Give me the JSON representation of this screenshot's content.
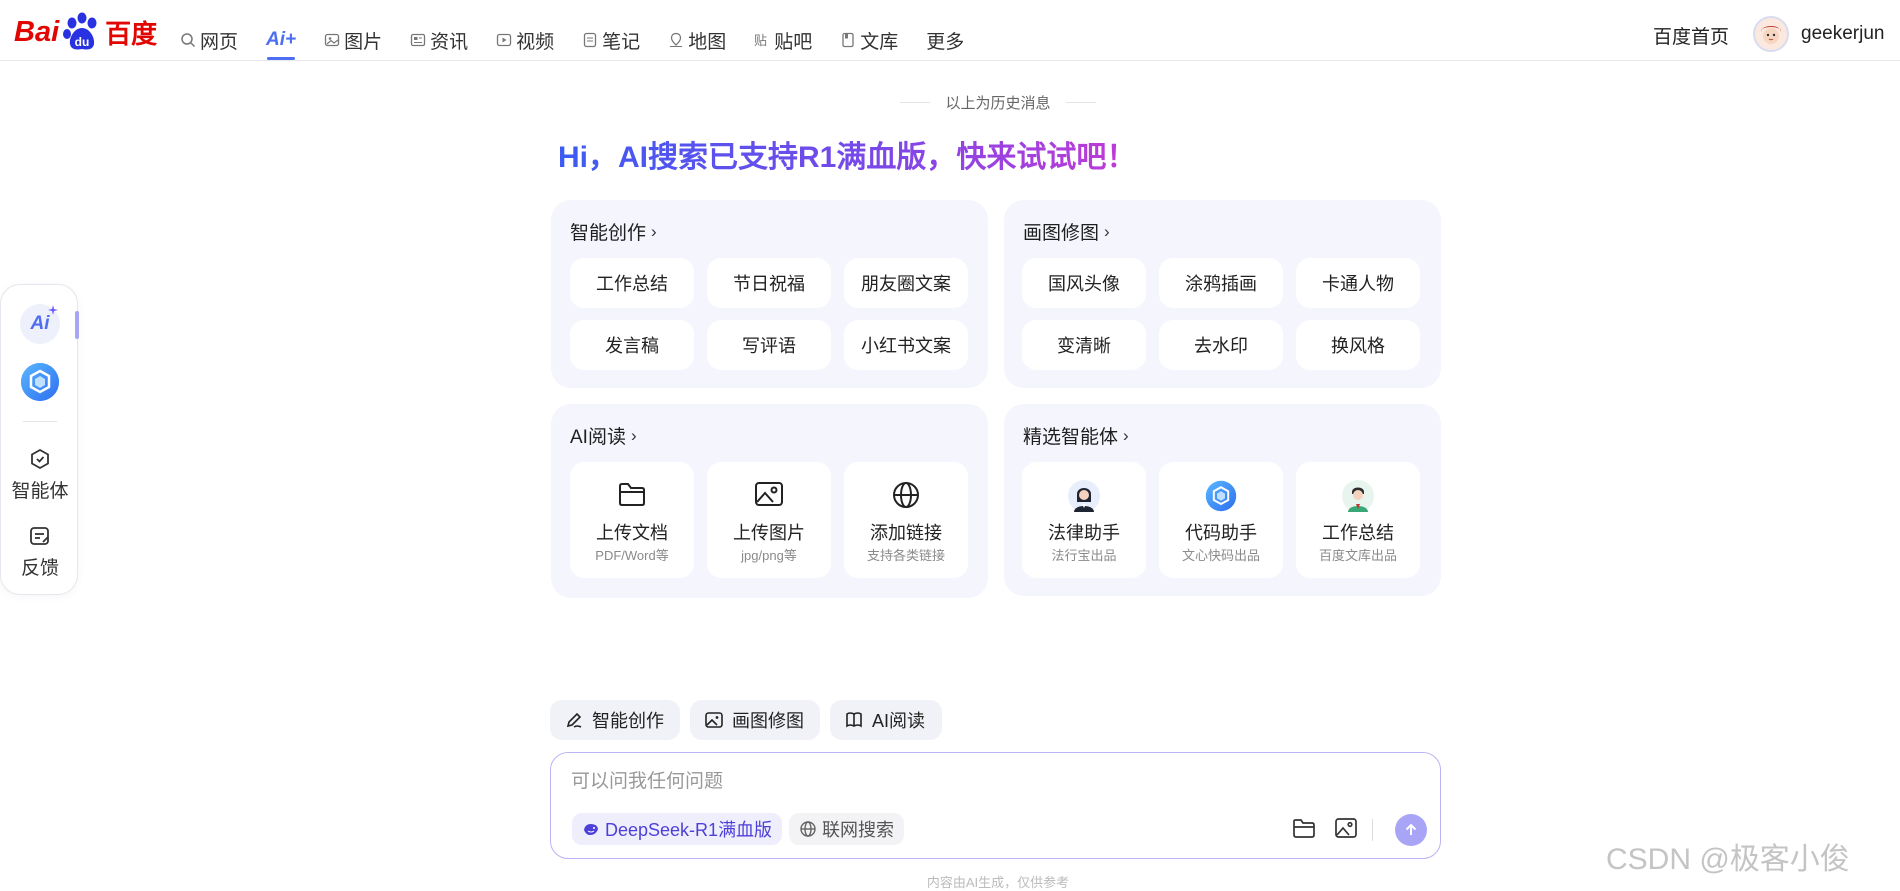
{
  "header": {
    "logo": {
      "bai": "Bai",
      "du": "du",
      "cn": "百度"
    },
    "nav": [
      {
        "label": "网页",
        "icon": "search-icon"
      },
      {
        "label": "Ai+",
        "icon": "ai-plus",
        "active": true
      },
      {
        "label": "图片",
        "icon": "image-icon"
      },
      {
        "label": "资讯",
        "icon": "news-icon"
      },
      {
        "label": "视频",
        "icon": "video-icon"
      },
      {
        "label": "笔记",
        "icon": "note-icon"
      },
      {
        "label": "地图",
        "icon": "map-icon"
      },
      {
        "label": "贴吧",
        "icon": "tieba-icon"
      },
      {
        "label": "文库",
        "icon": "doc-icon"
      },
      {
        "label": "更多",
        "icon": ""
      }
    ],
    "home_link": "百度首页",
    "username": "geekerjun"
  },
  "sidebar": {
    "ai_label": "Ai",
    "tools": [
      {
        "label": "智能体",
        "icon": "agent-icon"
      },
      {
        "label": "反馈",
        "icon": "feedback-icon"
      }
    ]
  },
  "main": {
    "history_notice": "以上为历史消息",
    "headline": "Hi，AI搜索已支持R1满血版，快来试试吧！",
    "cards": [
      {
        "title": "智能创作",
        "chips": [
          "工作总结",
          "节日祝福",
          "朋友圈文案",
          "发言稿",
          "写评语",
          "小红书文案"
        ]
      },
      {
        "title": "画图修图",
        "chips": [
          "国风头像",
          "涂鸦插画",
          "卡通人物",
          "变清晰",
          "去水印",
          "换风格"
        ]
      },
      {
        "title": "AI阅读",
        "tiles": [
          {
            "title": "上传文档",
            "sub": "PDF/Word等",
            "icon": "folder-icon"
          },
          {
            "title": "上传图片",
            "sub": "jpg/png等",
            "icon": "image-icon"
          },
          {
            "title": "添加链接",
            "sub": "支持各类链接",
            "icon": "globe-icon"
          }
        ]
      },
      {
        "title": "精选智能体",
        "tiles": [
          {
            "title": "法律助手",
            "sub": "法行宝出品",
            "icon": "lawyer-avatar-icon"
          },
          {
            "title": "代码助手",
            "sub": "文心快码出品",
            "icon": "code-cube-icon"
          },
          {
            "title": "工作总结",
            "sub": "百度文库出品",
            "icon": "worker-avatar-icon"
          }
        ]
      }
    ]
  },
  "composer": {
    "quick_actions": [
      {
        "label": "智能创作",
        "icon": "pen-icon"
      },
      {
        "label": "画图修图",
        "icon": "picture-icon"
      },
      {
        "label": "AI阅读",
        "icon": "book-icon"
      }
    ],
    "placeholder": "可以问我任何问题",
    "model_label": "DeepSeek-R1满血版",
    "web_search_label": "联网搜索",
    "disclaimer": "内容由AI生成，仅供参考"
  },
  "watermark": "CSDN @极客小俊",
  "colors": {
    "brand_red": "#e10602",
    "accent_blue": "#4e6ef2",
    "card_bg": "#f4f5fd",
    "send": "#a8a5f7"
  }
}
